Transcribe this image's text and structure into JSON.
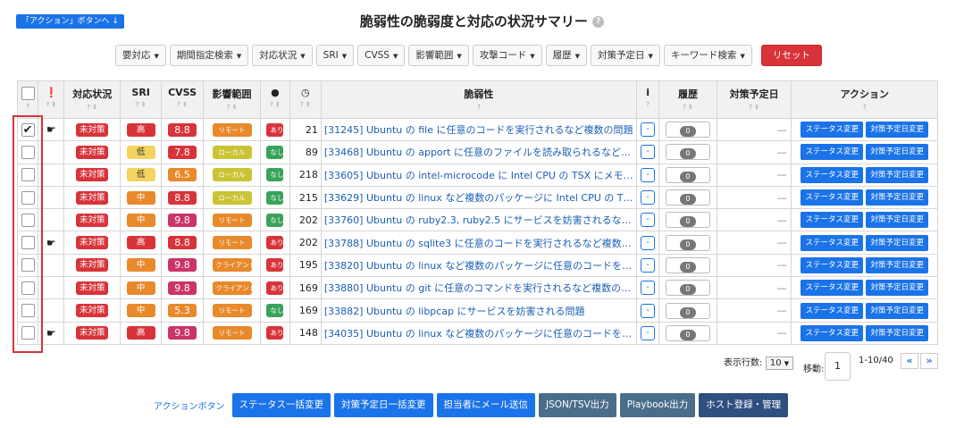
{
  "jump_label": "「アクション」ボタンへ ↓",
  "title": "脆弱性の脆弱度と対応の状況サマリー",
  "filters": [
    "要対応",
    "期間指定検索",
    "対応状況",
    "SRI",
    "CVSS",
    "影響範囲",
    "攻撃コード",
    "履歴",
    "対策予定日",
    "キーワード検索"
  ],
  "reset": "リセット",
  "headers": {
    "status": "対応状況",
    "sri": "SRI",
    "cvss": "CVSS",
    "range": "影響範囲",
    "vuln": "脆弱性",
    "info": "i",
    "history": "履歴",
    "date": "対策予定日",
    "action": "アクション"
  },
  "rows": [
    {
      "checked": true,
      "hand": true,
      "status": "未対策",
      "sri": "高",
      "sri_lvl": "high",
      "cvss": "8.8",
      "cv": "red",
      "range": "リモート",
      "rc": "remote",
      "expl": "あり",
      "count": "21",
      "vuln": "[31245] Ubuntu の file に任意のコードを実行されるなど複数の問題",
      "info": "-",
      "hist": "0",
      "date": "—"
    },
    {
      "checked": false,
      "hand": false,
      "status": "未対策",
      "sri": "低",
      "sri_lvl": "low",
      "cvss": "7.8",
      "cv": "red",
      "range": "ローカル",
      "rc": "local",
      "expl": "なし",
      "count": "89",
      "vuln": "[33468] Ubuntu の apport に任意のファイルを読み取られるなど複数の...",
      "info": "-",
      "hist": "0",
      "date": "—"
    },
    {
      "checked": false,
      "hand": false,
      "status": "未対策",
      "sri": "低",
      "sri_lvl": "low",
      "cvss": "6.5",
      "cv": "orange",
      "range": "ローカル",
      "rc": "local",
      "expl": "なし",
      "count": "218",
      "vuln": "[33605] Ubuntu の intel-microcode に Intel CPU の TSX にメモリ領域の...",
      "info": "-",
      "hist": "0",
      "date": "—"
    },
    {
      "checked": false,
      "hand": false,
      "status": "未対策",
      "sri": "中",
      "sri_lvl": "mid",
      "cvss": "8.8",
      "cv": "red",
      "range": "ローカル",
      "rc": "local",
      "expl": "なし",
      "count": "215",
      "vuln": "[33629] Ubuntu の linux など複数のパッケージに Intel CPU の TSX にメ...",
      "info": "-",
      "hist": "0",
      "date": "—"
    },
    {
      "checked": false,
      "hand": false,
      "status": "未対策",
      "sri": "中",
      "sri_lvl": "mid",
      "cvss": "9.8",
      "cv": "pink",
      "range": "リモート",
      "rc": "remote",
      "expl": "なし",
      "count": "202",
      "vuln": "[33760] Ubuntu の ruby2.3, ruby2.5 にサービスを妨害されるなど複数の...",
      "info": "-",
      "hist": "0",
      "date": "—"
    },
    {
      "checked": false,
      "hand": true,
      "status": "未対策",
      "sri": "高",
      "sri_lvl": "high",
      "cvss": "8.8",
      "cv": "red",
      "range": "リモート",
      "rc": "remote",
      "expl": "あり",
      "count": "202",
      "vuln": "[33788] Ubuntu の sqlite3 に任意のコードを実行されるなど複数の問題",
      "info": "-",
      "hist": "0",
      "date": "—"
    },
    {
      "checked": false,
      "hand": false,
      "status": "未対策",
      "sri": "中",
      "sri_lvl": "mid",
      "cvss": "9.8",
      "cv": "pink",
      "range": "クライアント",
      "rc": "client",
      "expl": "あり",
      "count": "195",
      "vuln": "[33820] Ubuntu の linux など複数のパッケージに任意のコードを実行さ...",
      "info": "-",
      "hist": "0",
      "date": "—"
    },
    {
      "checked": false,
      "hand": false,
      "status": "未対策",
      "sri": "中",
      "sri_lvl": "mid",
      "cvss": "9.8",
      "cv": "pink",
      "range": "クライアント",
      "rc": "client",
      "expl": "あり",
      "count": "169",
      "vuln": "[33880] Ubuntu の git に任意のコマンドを実行されるなど複数の問題",
      "info": "-",
      "hist": "0",
      "date": "—"
    },
    {
      "checked": false,
      "hand": false,
      "status": "未対策",
      "sri": "中",
      "sri_lvl": "mid",
      "cvss": "5.3",
      "cv": "orange",
      "range": "リモート",
      "rc": "remote",
      "expl": "なし",
      "count": "169",
      "vuln": "[33882] Ubuntu の libpcap にサービスを妨害される問題",
      "info": "-",
      "hist": "0",
      "date": "—"
    },
    {
      "checked": false,
      "hand": true,
      "status": "未対策",
      "sri": "高",
      "sri_lvl": "high",
      "cvss": "9.8",
      "cv": "pink",
      "range": "リモート",
      "rc": "remote",
      "expl": "あり",
      "count": "148",
      "vuln": "[34035] Ubuntu の linux など複数のパッケージに任意のコードを実行さ...",
      "info": "-",
      "hist": "0",
      "date": "—"
    }
  ],
  "row_actions": {
    "status_change": "ステータス変更",
    "date_change": "対策予定日変更"
  },
  "pager": {
    "rows_label": "表示行数:",
    "rows_value": "10",
    "move_label": "移動:",
    "page": "1",
    "range": "1-10/40",
    "first": "«",
    "next": "»"
  },
  "bottom": {
    "label": "アクションボタン",
    "buttons": [
      "ステータス一括変更",
      "対策予定日一括変更",
      "担当者にメール送信",
      "JSON/TSV出力",
      "Playbook出力",
      "ホスト登録・管理"
    ]
  },
  "colors": {
    "accent": "#1a73e8",
    "danger": "#d9333a"
  }
}
